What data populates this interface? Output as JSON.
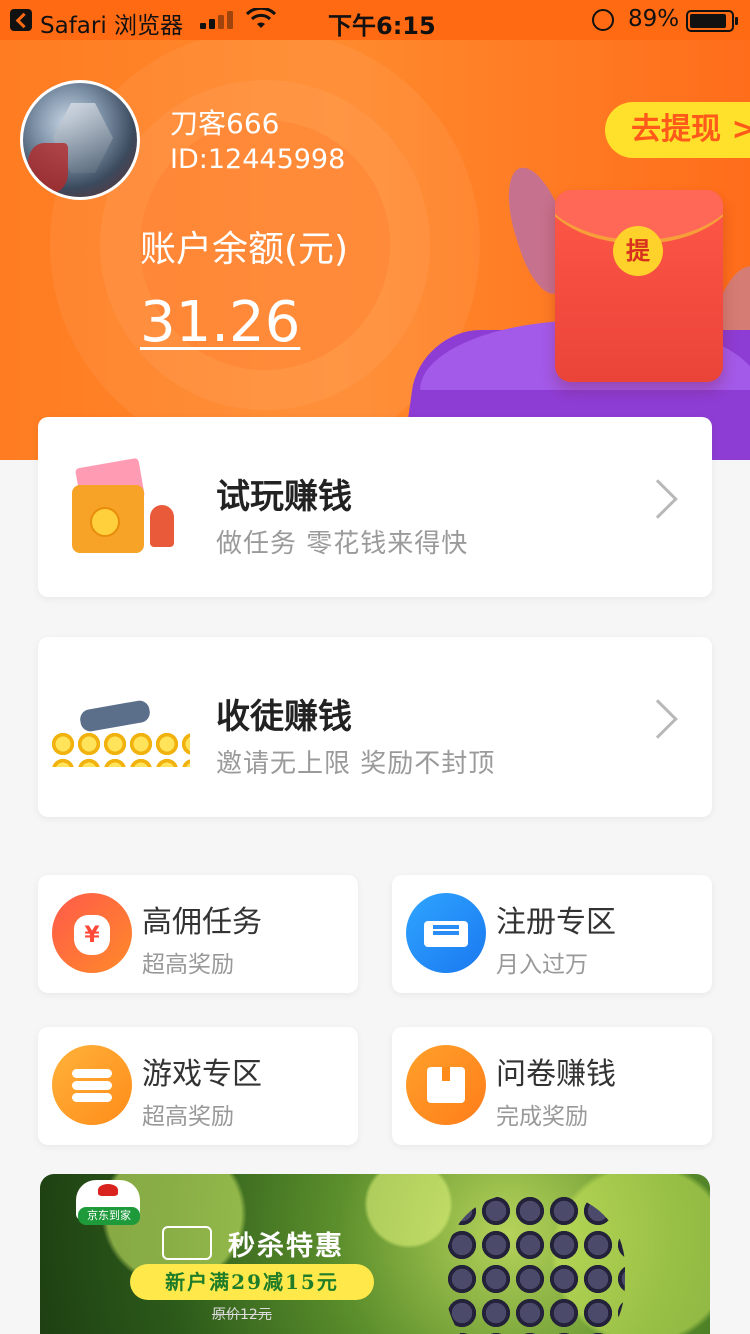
{
  "status_bar": {
    "app": "Safari 浏览器",
    "time": "下午6:15",
    "battery": "89%"
  },
  "profile": {
    "username": "刀客666",
    "user_id": "ID:12445998",
    "balance_label": "账户余额(元)",
    "balance": "31.26",
    "withdraw": "去提现 >",
    "envelope_char": "提"
  },
  "cards": [
    {
      "title": "试玩赚钱",
      "subtitle": "做任务  零花钱来得快"
    },
    {
      "title": "收徒赚钱",
      "subtitle": "邀请无上限  奖励不封顶"
    }
  ],
  "tiles": [
    {
      "label": "高佣任务",
      "desc": "超高奖励",
      "icon": "money-bag-icon"
    },
    {
      "label": "注册专区",
      "desc": "月入过万",
      "icon": "ticket-icon"
    },
    {
      "label": "游戏专区",
      "desc": "超高奖励",
      "icon": "coin-stack-icon"
    },
    {
      "label": "问卷赚钱",
      "desc": "完成奖励",
      "icon": "gift-box-icon"
    }
  ],
  "banner": {
    "brand": "京东到家",
    "headline": "秒杀特惠",
    "promo": "新户满29减15元",
    "original_price": "原价12元"
  },
  "colors": {
    "header": "#ff7c22",
    "accent_yellow": "#ffe12b",
    "withdraw_text": "#ff5a1a"
  }
}
